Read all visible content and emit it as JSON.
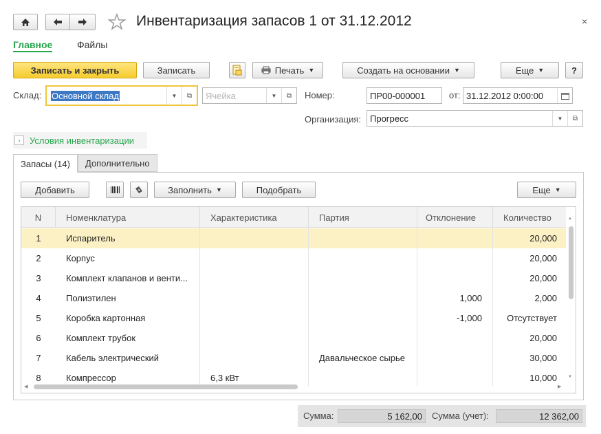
{
  "window": {
    "title": "Инвентаризация запасов 1 от 31.12.2012",
    "close_glyph": "×"
  },
  "nav": {
    "tabs": [
      "Главное",
      "Файлы"
    ]
  },
  "toolbar": {
    "save_close_label": "Записать и закрыть",
    "save_label": "Записать",
    "print_label": "Печать",
    "create_based_label": "Создать на основании",
    "more_label": "Еще",
    "help_label": "?"
  },
  "form": {
    "warehouse_label": "Склад:",
    "warehouse_value": "Основной склад",
    "cell_placeholder": "Ячейка",
    "number_label": "Номер:",
    "number_value": "ПР00-000001",
    "date_label": "от:",
    "date_value": "31.12.2012  0:00:00",
    "org_label": "Организация:",
    "org_value": "Прогресс",
    "conditions_label": "Условия инвентаризации"
  },
  "tabs": {
    "stock_label": "Запасы (14)",
    "extra_label": "Дополнительно"
  },
  "table_toolbar": {
    "add_label": "Добавить",
    "fill_label": "Заполнить",
    "pick_label": "Подобрать",
    "more_label": "Еще"
  },
  "table": {
    "headers": [
      "N",
      "Номенклатура",
      "Характеристика",
      "Партия",
      "Отклонение",
      "Количество"
    ],
    "rows": [
      {
        "n": "1",
        "name": "Испаритель",
        "char": "",
        "batch": "",
        "dev": "",
        "qty": "20,000"
      },
      {
        "n": "2",
        "name": "Корпус",
        "char": "",
        "batch": "",
        "dev": "",
        "qty": "20,000"
      },
      {
        "n": "3",
        "name": "Комплект клапанов и венти...",
        "char": "",
        "batch": "",
        "dev": "",
        "qty": "20,000"
      },
      {
        "n": "4",
        "name": "Полиэтилен",
        "char": "",
        "batch": "",
        "dev": "1,000",
        "qty": "2,000"
      },
      {
        "n": "5",
        "name": "Коробка картонная",
        "char": "",
        "batch": "",
        "dev": "-1,000",
        "qty": "Отсутствует"
      },
      {
        "n": "6",
        "name": "Комплект трубок",
        "char": "",
        "batch": "",
        "dev": "",
        "qty": "20,000"
      },
      {
        "n": "7",
        "name": "Кабель электрический",
        "char": "",
        "batch": "Давальческое сырье",
        "dev": "",
        "qty": "30,000"
      },
      {
        "n": "8",
        "name": "Компрессор",
        "char": "6,3 кВт",
        "batch": "",
        "dev": "",
        "qty": "10,000"
      }
    ]
  },
  "footer": {
    "sum_label": "Сумма:",
    "sum_value": "5 162,00",
    "sum_acc_label": "Сумма (учет):",
    "sum_acc_value": "12 362,00"
  },
  "colors": {
    "accent_green": "#27a54d",
    "primary_button": "#f5cb2e",
    "selected_row": "#fbf1c4"
  }
}
